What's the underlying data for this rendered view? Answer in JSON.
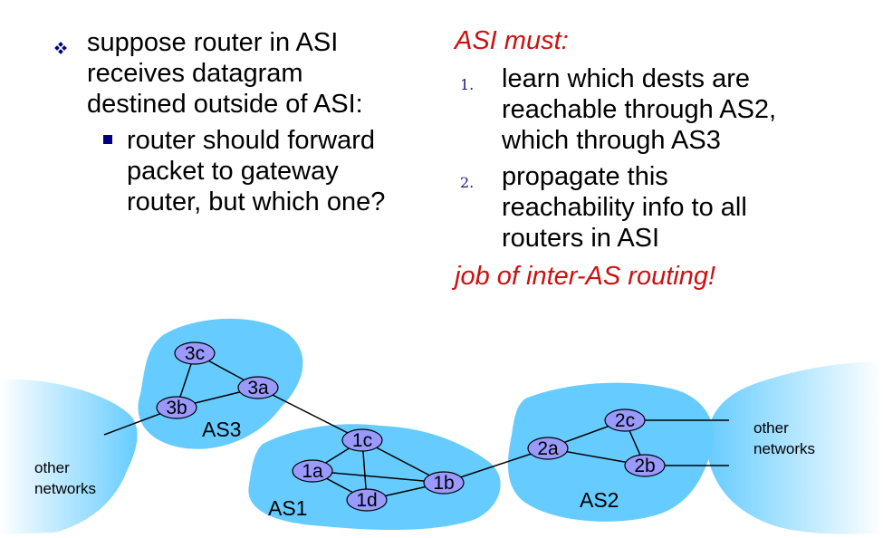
{
  "left": {
    "bullet": "suppose router in AS1 receives datagram destined outside of AS1:",
    "bullet_lines": [
      "suppose router in ASI",
      "receives datagram",
      "destined outside of ASI:"
    ],
    "sub_bullet_lines": [
      "router should forward",
      "packet to gateway",
      "router, but which one?"
    ]
  },
  "right": {
    "heading": "ASI must:",
    "items": [
      {
        "num": "1.",
        "lines": [
          "learn which dests are",
          "reachable through AS2,",
          "which through AS3"
        ]
      },
      {
        "num": "2.",
        "lines": [
          "propagate this",
          "reachability info to all",
          "routers in ASI"
        ]
      }
    ],
    "footer": "job of inter-AS routing!"
  },
  "diagram": {
    "as_labels": {
      "as1": "AS1",
      "as2": "AS2",
      "as3": "AS3"
    },
    "routers": {
      "r3a": "3a",
      "r3b": "3b",
      "r3c": "3c",
      "r1a": "1a",
      "r1b": "1b",
      "r1c": "1c",
      "r1d": "1d",
      "r2a": "2a",
      "r2b": "2b",
      "r2c": "2c"
    },
    "other_networks_left": [
      "other",
      "networks"
    ],
    "other_networks_right": [
      "other",
      "networks"
    ],
    "colors": {
      "cloud": "#66ccff",
      "router_fill": "#9999ff",
      "accent_red": "#cc1111",
      "bullet_blue": "#000080"
    }
  }
}
